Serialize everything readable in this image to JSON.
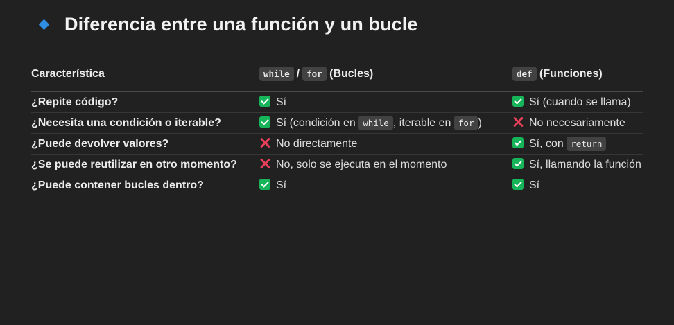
{
  "heading": {
    "title": "Diferencia entre una función y un bucle",
    "bullet_color": "#2f8de4"
  },
  "table": {
    "headers": {
      "feature": "Característica",
      "loops_code_1": "while",
      "loops_sep": "/",
      "loops_code_2": "for",
      "loops_label": "(Bucles)",
      "funcs_code": "def",
      "funcs_label": "(Funciones)"
    },
    "rows": [
      {
        "feature": "¿Repite código?",
        "loops": {
          "icon": "check-icon",
          "text": "Sí"
        },
        "funcs": {
          "icon": "check-icon",
          "text": "Sí (cuando se llama)"
        }
      },
      {
        "feature": "¿Necesita una condición o iterable?",
        "loops": {
          "icon": "check-icon",
          "text_a": "Sí (condición en",
          "code_a": "while",
          "text_b": ", iterable en",
          "code_b": "for",
          "text_c": ")"
        },
        "funcs": {
          "icon": "cross-icon",
          "text": "No necesariamente"
        }
      },
      {
        "feature": "¿Puede devolver valores?",
        "loops": {
          "icon": "cross-icon",
          "text": "No directamente"
        },
        "funcs": {
          "icon": "check-icon",
          "text": "Sí, con",
          "code": "return"
        }
      },
      {
        "feature": "¿Se puede reutilizar en otro momento?",
        "loops": {
          "icon": "cross-icon",
          "text": "No, solo se ejecuta en el momento"
        },
        "funcs": {
          "icon": "check-icon",
          "text": "Sí, llamando la función"
        }
      },
      {
        "feature": "¿Puede contener bucles dentro?",
        "loops": {
          "icon": "check-icon",
          "text": "Sí"
        },
        "funcs": {
          "icon": "check-icon",
          "text": "Sí"
        }
      }
    ]
  },
  "colors": {
    "background": "#212121",
    "check": "#16b55a",
    "cross": "#e8405a",
    "code_bg": "#424242"
  }
}
